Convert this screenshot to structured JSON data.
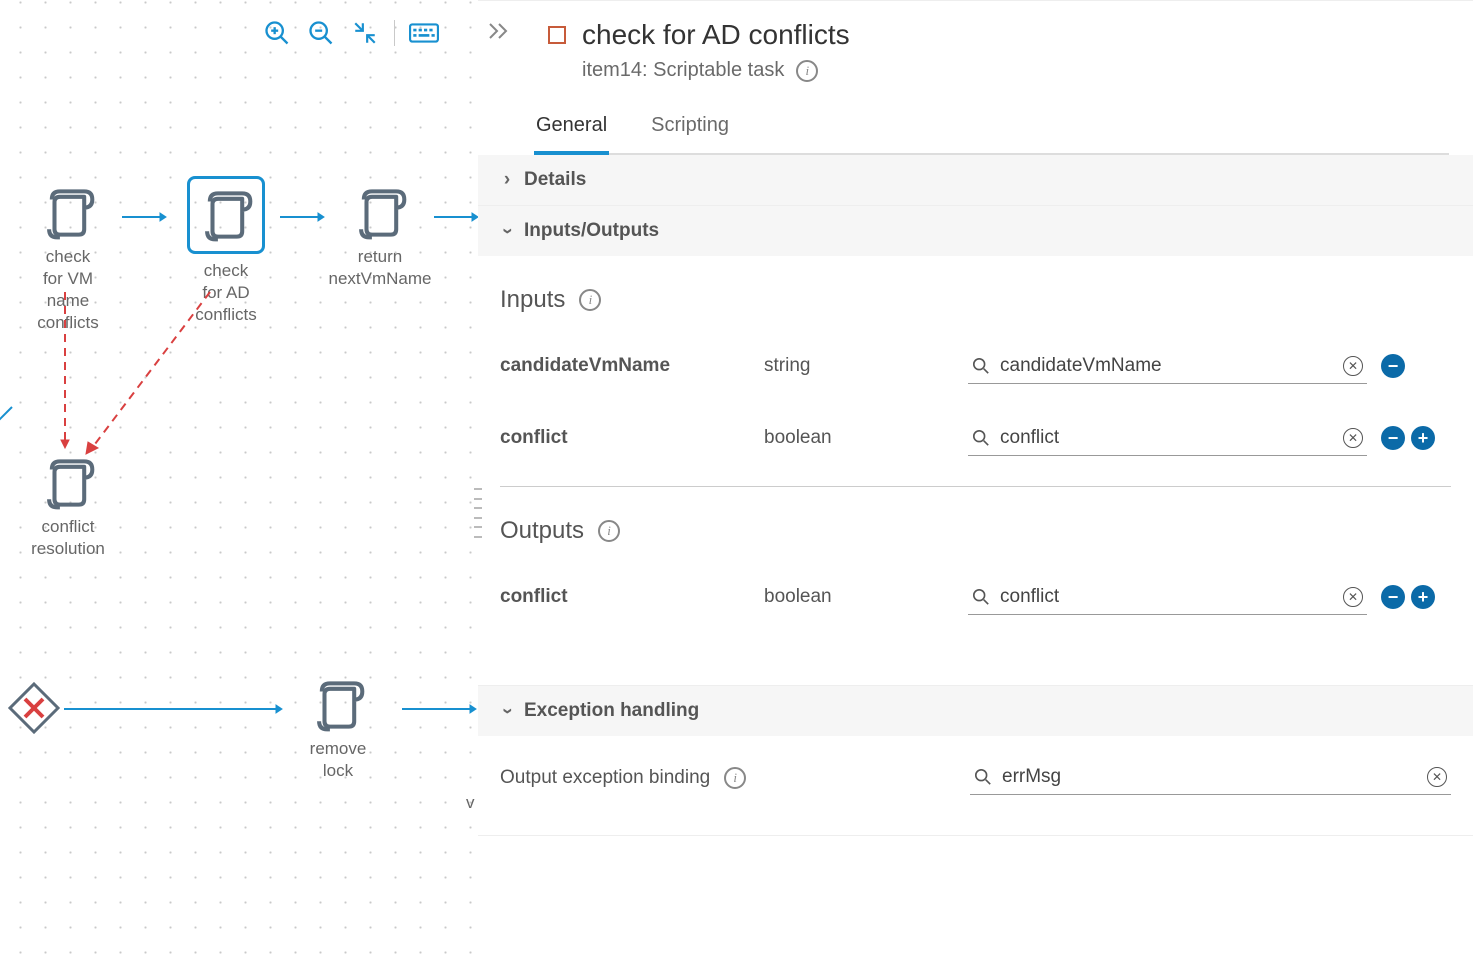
{
  "colors": {
    "accent": "#1890d0",
    "error": "#d94040",
    "taskIcon": "#c75b3a"
  },
  "canvas": {
    "toolbar": {
      "zoomIn": "zoom-in",
      "zoomOut": "zoom-out",
      "fit": "fit-to-screen",
      "keyboard": "keyboard-shortcuts"
    },
    "nodes": {
      "checkVmName": "check\nfor VM\nname\nconflicts",
      "checkAdConflicts": "check\nfor AD\nconflicts",
      "returnNextVmName": "return\nnextVmName",
      "conflictResolution": "conflict\nresolution",
      "removeLock": "remove\nlock",
      "wPartial": "v"
    }
  },
  "panel": {
    "title": "check for AD conflicts",
    "subtitle": "item14: Scriptable task",
    "tabs": {
      "general": "General",
      "scripting": "Scripting"
    },
    "sections": {
      "details": "Details",
      "inputsOutputs": "Inputs/Outputs",
      "exceptionHandling": "Exception handling"
    },
    "inputsHeading": "Inputs",
    "outputsHeading": "Outputs",
    "inputs": [
      {
        "name": "candidateVmName",
        "type": "string",
        "binding": "candidateVmName",
        "showPlus": false
      },
      {
        "name": "conflict",
        "type": "boolean",
        "binding": "conflict",
        "showPlus": true
      }
    ],
    "outputs": [
      {
        "name": "conflict",
        "type": "boolean",
        "binding": "conflict",
        "showPlus": true
      }
    ],
    "exceptionLabel": "Output exception binding",
    "exceptionBinding": "errMsg"
  }
}
